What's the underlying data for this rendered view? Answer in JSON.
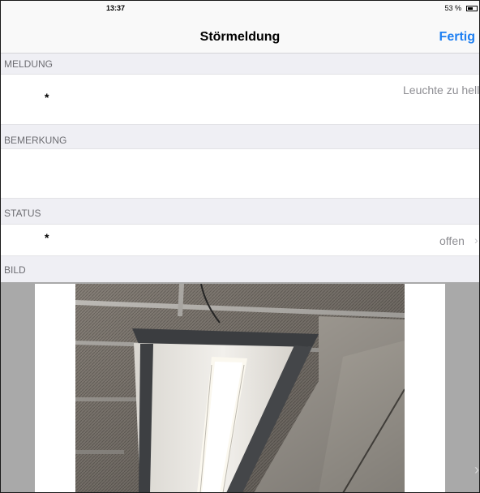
{
  "statusbar": {
    "time": "13:37",
    "battery": "53 %"
  },
  "navbar": {
    "title": "Störmeldung",
    "done_label": "Fertig"
  },
  "sections": {
    "meldung": {
      "header": "MELDUNG",
      "required_mark": "*",
      "value": "Leuchte zu hell"
    },
    "bemerkung": {
      "header": "BEMERKUNG",
      "value": ""
    },
    "status": {
      "header": "STATUS",
      "required_mark": "*",
      "value": "offen",
      "chevron": "›"
    },
    "bild": {
      "header": "BILD",
      "next_chevron": "›"
    }
  },
  "colors": {
    "accent": "#1d7ff2",
    "background": "#efeff4",
    "secondary_text": "#8e8e93"
  }
}
